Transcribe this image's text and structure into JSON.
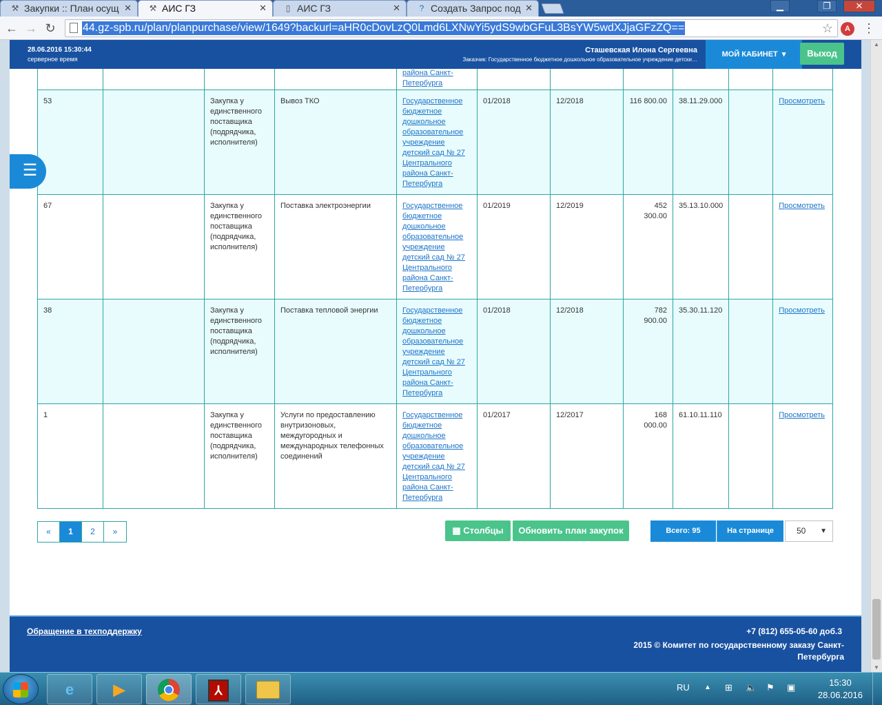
{
  "browser": {
    "tabs": [
      {
        "title": "Закупки :: План осущ",
        "icon": "hammer-icon"
      },
      {
        "title": "АИС ГЗ",
        "icon": "hammer-icon"
      },
      {
        "title": "АИС ГЗ",
        "icon": "page-icon"
      },
      {
        "title": "Создать Запрос под",
        "icon": "help-icon"
      }
    ],
    "url": "44.gz-spb.ru/plan/planpurchase/view/1649?backurl=aHR0cDovLzQ0Lmd6LXNwYi5ydS9wbGFuL3BsYW5wdXJjaGFzZQ=="
  },
  "header": {
    "server_time": "28.06.2016 15:30:44",
    "server_time_label": "серверное время",
    "user_name": "Сташевская Илона Сергеевна",
    "customer": "Заказчик: Государственное бюджетное дошкольное образовательное учреждение детски…",
    "cabinet_label": "МОЙ КАБИНЕТ",
    "exit_label": "Выход"
  },
  "table": {
    "org_text": "Государственное бюджетное дошкольное образовательное учреждение детский сад № 27 Центрального района Санкт-Петербурга",
    "partial_top": {
      "org_tail": "района Санкт-Петербурга"
    },
    "rows": [
      {
        "id": "53",
        "method": "Закупка у единственного поставщика (подрядчика, исполнителя)",
        "name": "Вывоз ТКО",
        "start": "01/2018",
        "end": "12/2018",
        "sum": "116 800.00",
        "okpd": "38.11.29.000",
        "action": "Просмотреть"
      },
      {
        "id": "67",
        "method": "Закупка у единственного поставщика (подрядчика, исполнителя)",
        "name": "Поставка электроэнергии",
        "start": "01/2019",
        "end": "12/2019",
        "sum": "452 300.00",
        "okpd": "35.13.10.000",
        "action": "Просмотреть"
      },
      {
        "id": "38",
        "method": "Закупка у единственного поставщика (подрядчика, исполнителя)",
        "name": "Поставка тепловой энергии",
        "start": "01/2018",
        "end": "12/2018",
        "sum": "782 900.00",
        "okpd": "35.30.11.120",
        "action": "Просмотреть"
      },
      {
        "id": "1",
        "method": "Закупка у единственного поставщика (подрядчика, исполнителя)",
        "name": "Услуги по предоставлению внутризоновых, междугородных и международных телефонных соединений",
        "start": "01/2017",
        "end": "12/2017",
        "sum": "168 000.00",
        "okpd": "61.10.11.110",
        "action": "Просмотреть"
      }
    ]
  },
  "pagination": {
    "prev": "«",
    "pages": [
      "1",
      "2"
    ],
    "next": "»",
    "current": "1"
  },
  "actions": {
    "columns_label": "Столбцы",
    "refresh_label": "Обновить план закупок",
    "total_label": "Всего: 95",
    "per_page_label": "На странице",
    "per_page_value": "50"
  },
  "footer": {
    "support_link": "Обращение в техподдержку",
    "phone": "+7 (812) 655-05-60 доб.3",
    "copyright": "2015 © Комитет по государственному заказу Санкт-Петербурга"
  },
  "taskbar": {
    "lang": "RU",
    "time": "15:30",
    "date": "28.06.2016",
    "apps": [
      "ie-icon",
      "media-player-icon",
      "chrome-icon",
      "acrobat-icon",
      "explorer-icon"
    ]
  },
  "colors": {
    "header_blue": "#1851a0",
    "accent_blue": "#1a8ad8",
    "green": "#4bc48c",
    "row_alt": "#e9fcfd",
    "border_teal": "#2aa5a3"
  }
}
